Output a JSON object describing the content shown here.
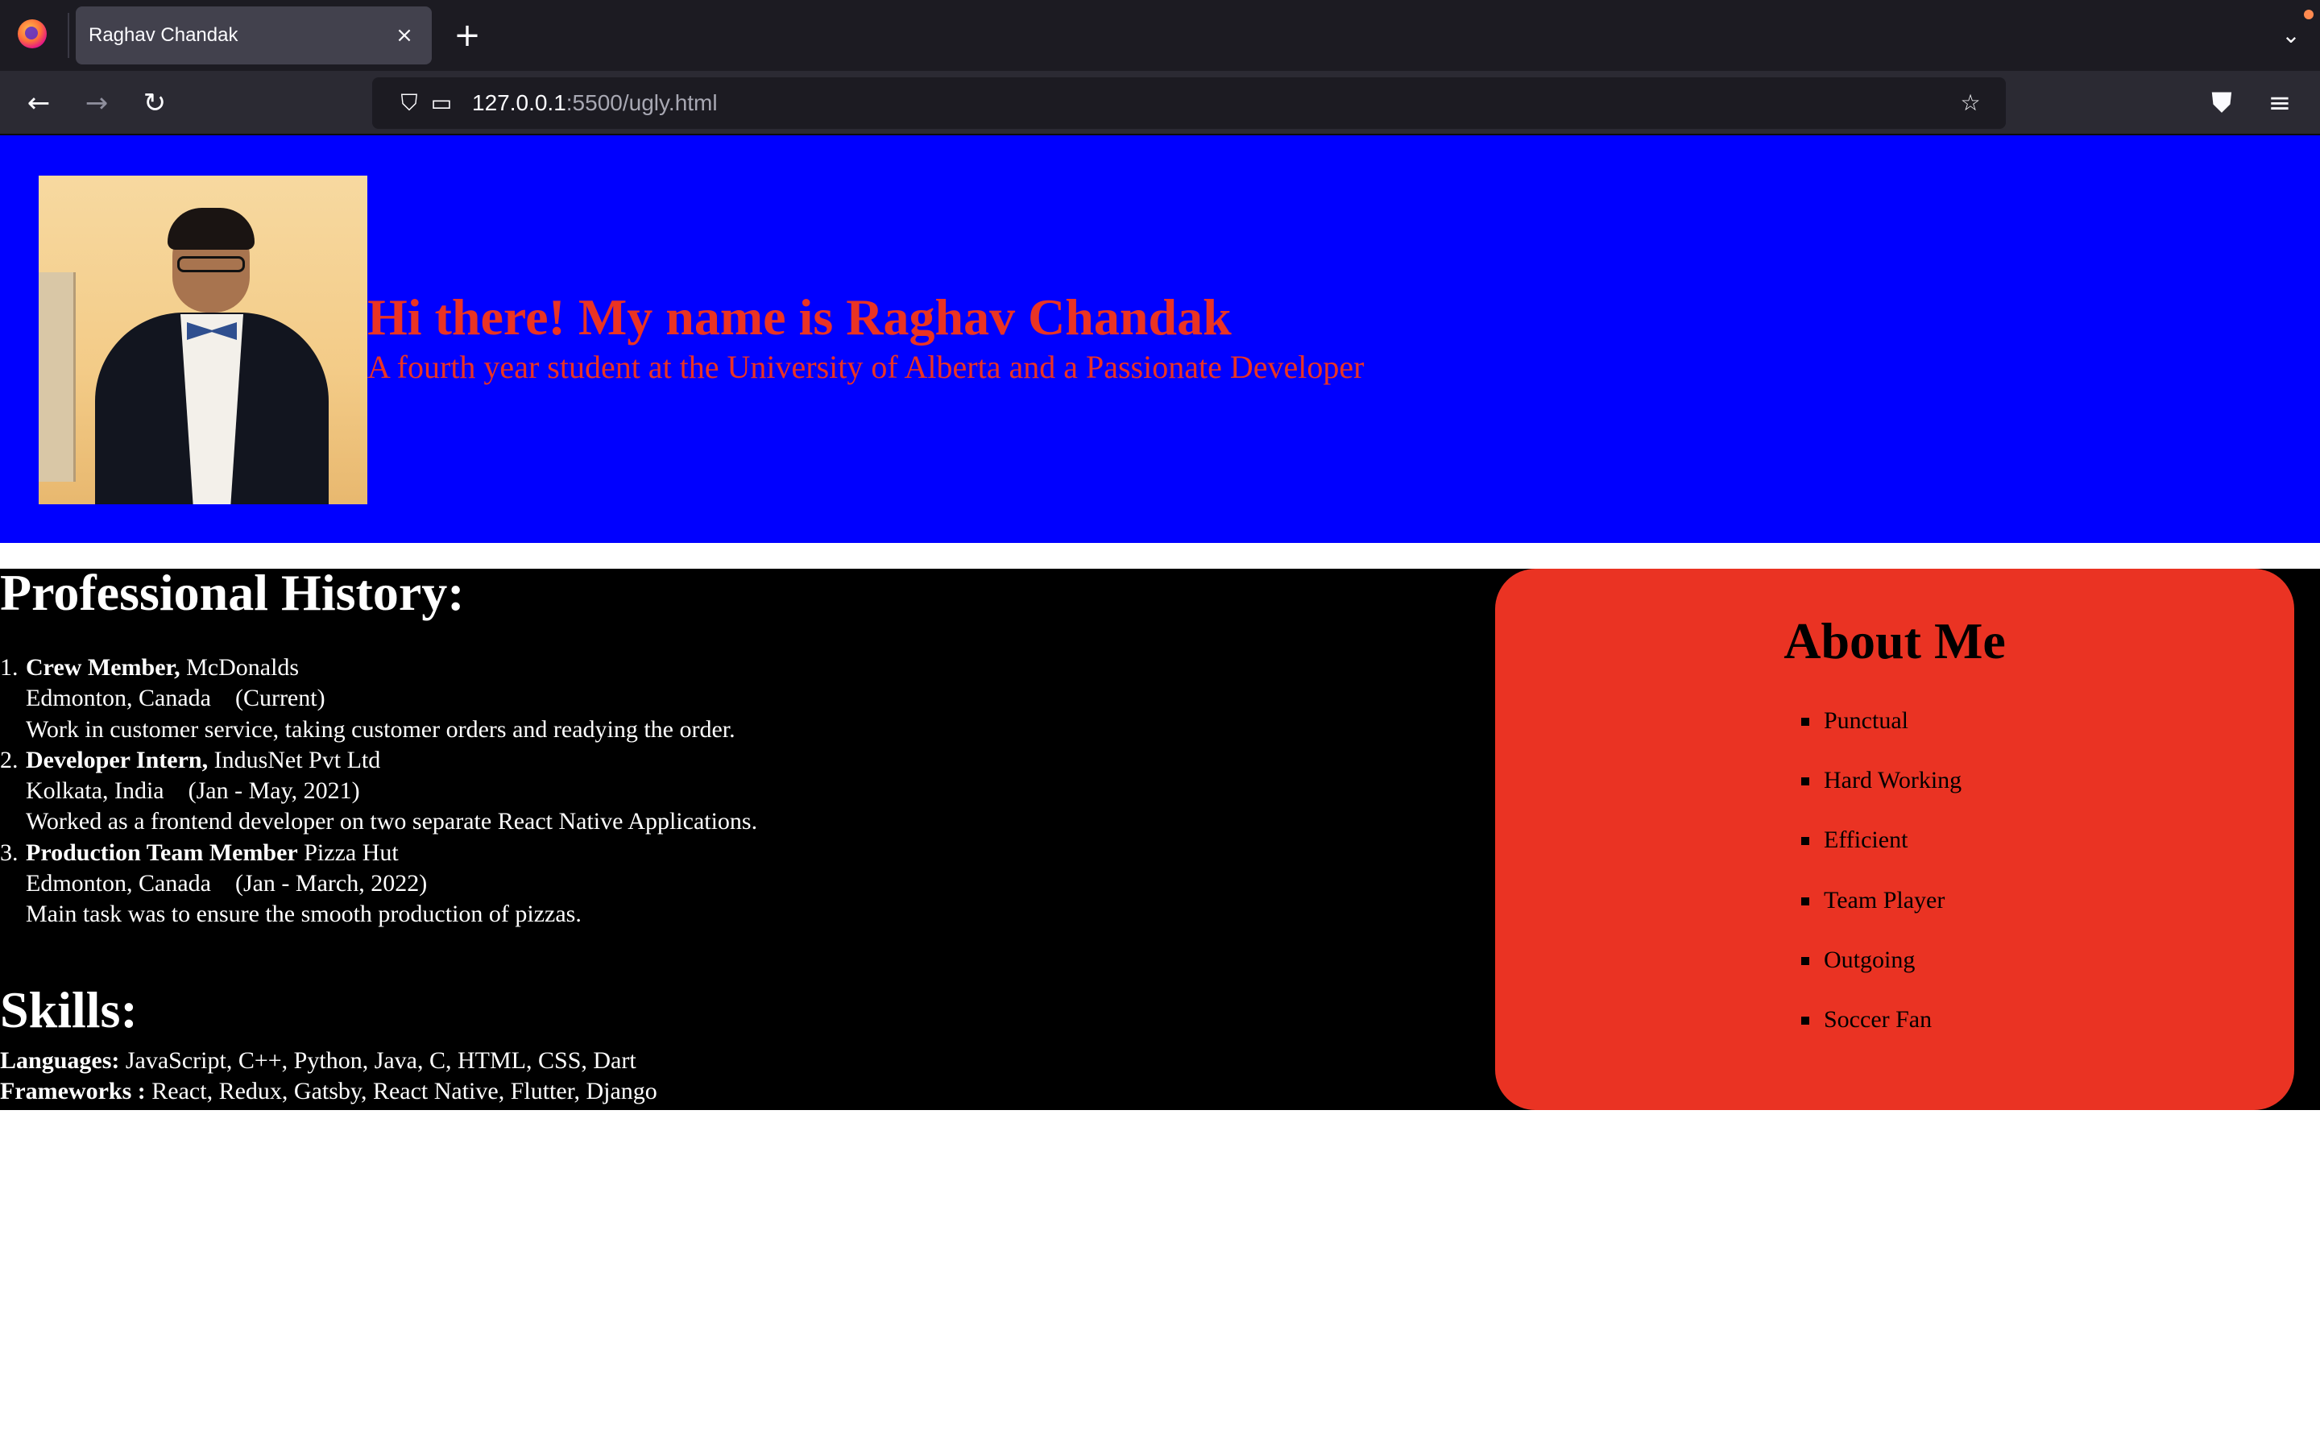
{
  "browser": {
    "tab_title": "Raghav Chandak",
    "tab_close": "×",
    "new_tab": "+",
    "url_host": "127.0.0.1",
    "url_rest": ":5500/ugly.html",
    "icons": {
      "back": "←",
      "forward": "→",
      "reload": "↻",
      "shield": "⛉",
      "page": "▭",
      "bookmark": "☆",
      "pocket": "⛊",
      "menu": "≡",
      "tab_list": "⌄"
    }
  },
  "hero": {
    "title": "Hi there! My name is Raghav Chandak",
    "subtitle": "A fourth year student at the University of Alberta and a Passionate Developer"
  },
  "history": {
    "heading": "Professional History:",
    "items": [
      {
        "number": "1.",
        "role": "Crew Member,",
        "company": "McDonalds",
        "location": "Edmonton, Canada",
        "period": "(Current)",
        "description": "Work in customer service, taking customer orders and readying the order."
      },
      {
        "number": "2.",
        "role": "Developer Intern,",
        "company": "IndusNet Pvt Ltd",
        "location": "Kolkata, India",
        "period": "(Jan - May, 2021)",
        "description": "Worked as a frontend developer on two separate React Native Applications."
      },
      {
        "number": "3.",
        "role": "Production Team Member",
        "company": "Pizza Hut",
        "location": "Edmonton, Canada",
        "period": "(Jan - March, 2022)",
        "description": "Main task was to ensure the smooth production of pizzas."
      }
    ]
  },
  "skills": {
    "heading": "Skills:",
    "languages_label": "Languages:",
    "languages": "JavaScript, C++, Python, Java, C, HTML, CSS, Dart",
    "frameworks_label": "Frameworks :",
    "frameworks": "React, Redux, Gatsby, React Native, Flutter, Django"
  },
  "about": {
    "heading": "About Me",
    "items": [
      "Punctual",
      "Hard Working",
      "Efficient",
      "Team Player",
      "Outgoing",
      "Soccer Fan"
    ]
  },
  "colors": {
    "header_bg": "#0000ff",
    "accent_red": "#ea3323",
    "content_bg": "#000000"
  }
}
